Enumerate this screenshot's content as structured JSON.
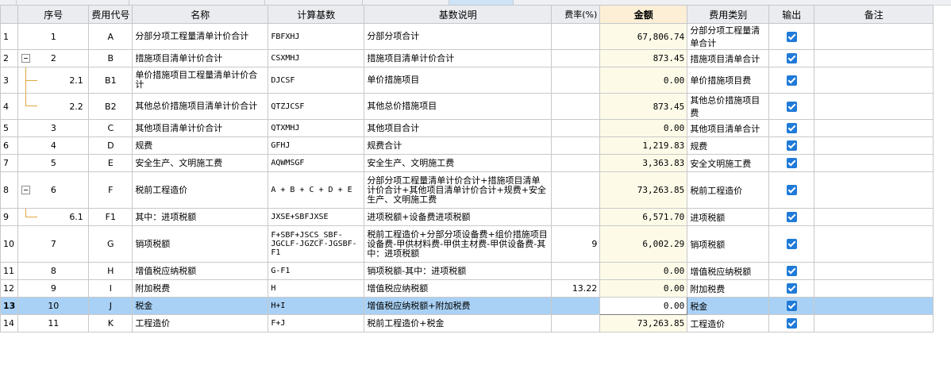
{
  "colors": {
    "header_bg": "#eaecef",
    "amount_header_bg": "#fcefd6",
    "amount_cell_bg": "#fdfbe8",
    "selected_row_bg": "#a9d1f5",
    "checkbox_blue": "#1f7ad8",
    "tree_line": "#e0a840"
  },
  "icons": {
    "expand_box": "collapse-minus-icon",
    "checkbox": "checkbox-checked-icon"
  },
  "headers": {
    "seq": "序号",
    "code": "费用代号",
    "name": "名称",
    "base": "计算基数",
    "base_desc": "基数说明",
    "rate": "费率(%)",
    "amount": "金额",
    "category": "费用类别",
    "output": "输出",
    "remark": "备注"
  },
  "rows": [
    {
      "rownum": "1",
      "seq": "1",
      "code": "A",
      "name": "分部分项工程量清单计价合计",
      "base": "FBFXHJ",
      "base_desc": "分部分项合计",
      "rate": "",
      "amount": "67,806.74",
      "category": "分部分项工程量清单合计",
      "output": true,
      "remark": ""
    },
    {
      "rownum": "2",
      "seq": "2",
      "code": "B",
      "name": "措施项目清单计价合计",
      "base": "CSXMHJ",
      "base_desc": "措施项目清单计价合计",
      "rate": "",
      "amount": "873.45",
      "category": "措施项目清单合计",
      "output": true,
      "remark": ""
    },
    {
      "rownum": "3",
      "seq": "2.1",
      "code": "B1",
      "name": "单价措施项目工程量清单计价合计",
      "base": "DJCSF",
      "base_desc": "单价措施项目",
      "rate": "",
      "amount": "0.00",
      "category": "单价措施项目费",
      "output": true,
      "remark": ""
    },
    {
      "rownum": "4",
      "seq": "2.2",
      "code": "B2",
      "name": "其他总价措施项目清单计价合计",
      "base": "QTZJCSF",
      "base_desc": "其他总价措施项目",
      "rate": "",
      "amount": "873.45",
      "category": "其他总价措施项目费",
      "output": true,
      "remark": ""
    },
    {
      "rownum": "5",
      "seq": "3",
      "code": "C",
      "name": "其他项目清单计价合计",
      "base": "QTXMHJ",
      "base_desc": "其他项目合计",
      "rate": "",
      "amount": "0.00",
      "category": "其他项目清单合计",
      "output": true,
      "remark": ""
    },
    {
      "rownum": "6",
      "seq": "4",
      "code": "D",
      "name": "规费",
      "base": "GFHJ",
      "base_desc": "规费合计",
      "rate": "",
      "amount": "1,219.83",
      "category": "规费",
      "output": true,
      "remark": ""
    },
    {
      "rownum": "7",
      "seq": "5",
      "code": "E",
      "name": "安全生产、文明施工费",
      "base": "AQWMSGF",
      "base_desc": "安全生产、文明施工费",
      "rate": "",
      "amount": "3,363.83",
      "category": "安全文明施工费",
      "output": true,
      "remark": ""
    },
    {
      "rownum": "8",
      "seq": "6",
      "code": "F",
      "name": "税前工程造价",
      "base": "A + B + C + D + E",
      "base_desc": "分部分项工程量清单计价合计+措施项目清单计价合计+其他项目清单计价合计+规费+安全生产、文明施工费",
      "rate": "",
      "amount": "73,263.85",
      "category": "税前工程造价",
      "output": true,
      "remark": ""
    },
    {
      "rownum": "9",
      "seq": "6.1",
      "code": "F1",
      "name": "其中：进项税额",
      "base": "JXSE+SBFJXSE",
      "base_desc": "进项税额+设备费进项税额",
      "rate": "",
      "amount": "6,571.70",
      "category": "进项税额",
      "output": true,
      "remark": ""
    },
    {
      "rownum": "10",
      "seq": "7",
      "code": "G",
      "name": "销项税额",
      "base": "F+SBF+JSCS_SBF-JGCLF-JGZCF-JGSBF-F1",
      "base_desc": "税前工程造价+分部分项设备费+组价措施项目设备费-甲供材料费-甲供主材费-甲供设备费-其中：进项税额",
      "rate": "9",
      "amount": "6,002.29",
      "category": "销项税额",
      "output": true,
      "remark": ""
    },
    {
      "rownum": "11",
      "seq": "8",
      "code": "H",
      "name": "增值税应纳税额",
      "base": "G-F1",
      "base_desc": "销项税额-其中：进项税额",
      "rate": "",
      "amount": "0.00",
      "category": "增值税应纳税额",
      "output": true,
      "remark": ""
    },
    {
      "rownum": "12",
      "seq": "9",
      "code": "I",
      "name": "附加税费",
      "base": "H",
      "base_desc": "增值税应纳税额",
      "rate": "13.22",
      "amount": "0.00",
      "category": "附加税费",
      "output": true,
      "remark": ""
    },
    {
      "rownum": "13",
      "seq": "10",
      "code": "J",
      "name": "税金",
      "base": "H+I",
      "base_desc": "增值税应纳税额+附加税费",
      "rate": "",
      "amount": "0.00",
      "category": "税金",
      "output": true,
      "remark": ""
    },
    {
      "rownum": "14",
      "seq": "11",
      "code": "K",
      "name": "工程造价",
      "base": "F+J",
      "base_desc": "税前工程造价+税金",
      "rate": "",
      "amount": "73,263.85",
      "category": "工程造价",
      "output": true,
      "remark": ""
    }
  ]
}
